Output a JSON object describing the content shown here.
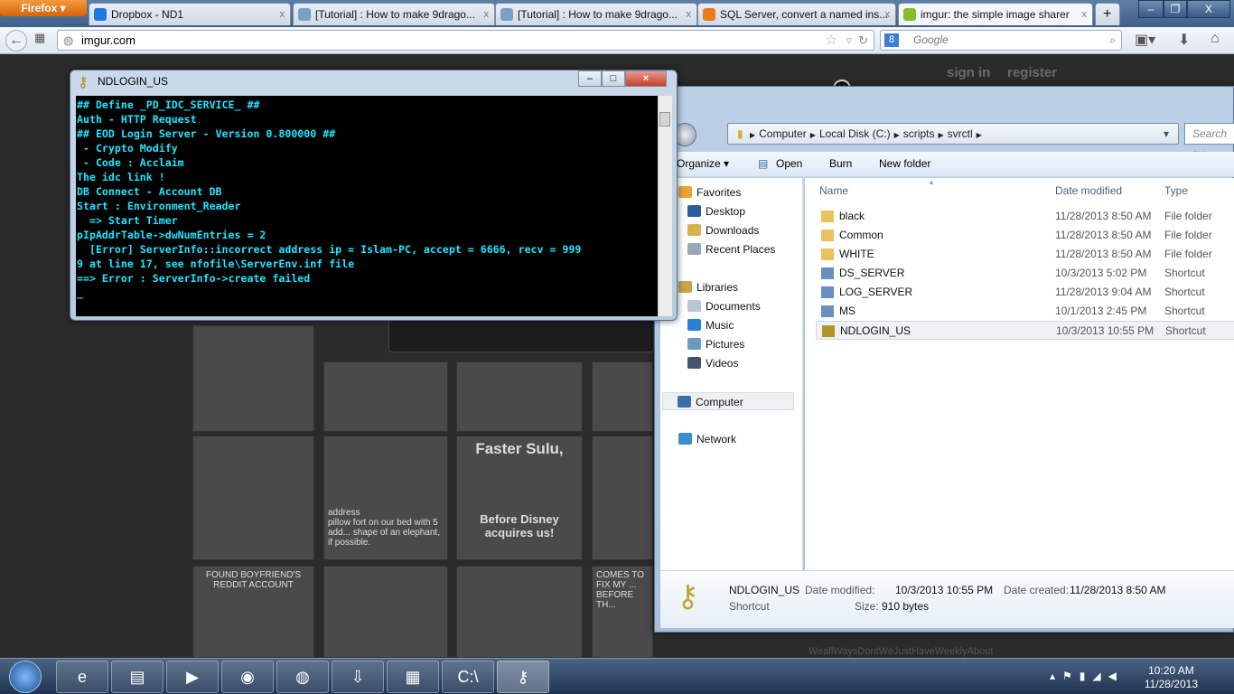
{
  "browser": {
    "menu_label": "Firefox",
    "tabs": [
      {
        "label": "Dropbox - ND1",
        "icon": "dropbox-icon",
        "color": "#1f7ae0"
      },
      {
        "label": "[Tutorial] : How to make 9drago...",
        "icon": "forum-icon",
        "color": "#7aa0c8"
      },
      {
        "label": "[Tutorial] : How to make 9drago...",
        "icon": "forum-icon",
        "color": "#7aa0c8"
      },
      {
        "label": "SQL Server, convert a named ins...",
        "icon": "stackoverflow-icon",
        "color": "#e87d1e"
      },
      {
        "label": "imgur: the simple image sharer",
        "icon": "imgur-icon",
        "color": "#85bf25"
      }
    ],
    "new_tab": "+",
    "url": "imgur.com",
    "search_placeholder": "Google"
  },
  "imgur": {
    "sign_in": "sign in",
    "register": "register",
    "thumbs": [
      "Faster Sulu,",
      "Before Disney acquires us!",
      "FOUND BOYFRIEND'S REDDIT ACCOUNT",
      "COMES TO FIX MY ... BEFORE TH...",
      "address",
      "pillow fort on our bed with 5 add... shape of an elephant, if possible.",
      "WeallWaysDontWeJustHaveWeeklyAbout"
    ]
  },
  "console": {
    "title": "NDLOGIN_US",
    "lines": [
      "## Define _PD_IDC_SERVICE_ ##",
      "Auth - HTTP Request",
      "## EOD Login Server - Version 0.800000 ##",
      "",
      " - Crypto Modify",
      " - Code : Acclaim",
      "The idc link !",
      "DB Connect - Account DB",
      "Start : Environment_Reader",
      "  => Start Timer",
      "pIpAddrTable->dwNumEntries = 2",
      "  [Error] ServerInfo::incorrect address ip = Islam-PC, accept = 6666, recv = 999",
      "9 at line 17, see nfofile\\ServerEnv.inf file",
      "==> Error : ServerInfo->create failed",
      "_"
    ],
    "text_color": "#1ee6ff"
  },
  "explorer": {
    "breadcrumb": [
      "Computer",
      "Local Disk (C:)",
      "scripts",
      "svrctl"
    ],
    "search_placeholder": "Search sv",
    "toolbar": {
      "organize": "Organize ▾",
      "open": "Open",
      "burn": "Burn",
      "new_folder": "New folder"
    },
    "nav": [
      {
        "label": "Favorites",
        "icon": "star-icon",
        "color": "#e8a33a"
      },
      {
        "label": "Desktop",
        "icon": "desktop-icon",
        "color": "#2c5d9a"
      },
      {
        "label": "Downloads",
        "icon": "downloads-icon",
        "color": "#d9b14a"
      },
      {
        "label": "Recent Places",
        "icon": "recent-places-icon",
        "color": "#9aa7b4"
      },
      {
        "label": "Libraries",
        "icon": "libraries-icon",
        "color": "#c9a54b"
      },
      {
        "label": "Documents",
        "icon": "documents-icon",
        "color": "#b8c6d4"
      },
      {
        "label": "Music",
        "icon": "music-icon",
        "color": "#2a7fd4"
      },
      {
        "label": "Pictures",
        "icon": "pictures-icon",
        "color": "#6c98c4"
      },
      {
        "label": "Videos",
        "icon": "videos-icon",
        "color": "#44556a"
      },
      {
        "label": "Computer",
        "icon": "computer-icon",
        "color": "#3a6ea8"
      },
      {
        "label": "Network",
        "icon": "network-icon",
        "color": "#3a8ed0"
      }
    ],
    "columns": {
      "name": "Name",
      "date": "Date modified",
      "type": "Type"
    },
    "files": [
      {
        "name": "black",
        "date": "11/28/2013 8:50 AM",
        "type": "File folder",
        "icon": "folder-icon"
      },
      {
        "name": "Common",
        "date": "11/28/2013 8:50 AM",
        "type": "File folder",
        "icon": "folder-icon"
      },
      {
        "name": "WHITE",
        "date": "11/28/2013 8:50 AM",
        "type": "File folder",
        "icon": "folder-icon"
      },
      {
        "name": "DS_SERVER",
        "date": "10/3/2013 5:02 PM",
        "type": "Shortcut",
        "icon": "shortcut-icon"
      },
      {
        "name": "LOG_SERVER",
        "date": "11/28/2013 9:04 AM",
        "type": "Shortcut",
        "icon": "shortcut-icon"
      },
      {
        "name": "MS",
        "date": "10/1/2013 2:45 PM",
        "type": "Shortcut",
        "icon": "shortcut-icon"
      },
      {
        "name": "NDLOGIN_US",
        "date": "10/3/2013 10:55 PM",
        "type": "Shortcut",
        "icon": "keys-shortcut-icon",
        "selected": true
      }
    ],
    "details": {
      "name": "NDLOGIN_US",
      "type": "Shortcut",
      "modified_label": "Date modified:",
      "modified": "10/3/2013 10:55 PM",
      "created_label": "Date created:",
      "created": "11/28/2013 8:50 AM",
      "size_label": "Size:",
      "size": "910 bytes"
    }
  },
  "taskbar": {
    "apps": [
      "ie-icon",
      "explorer-icon",
      "media-player-icon",
      "chrome-icon",
      "firefox-icon",
      "download-manager-icon",
      "control-panel-icon",
      "cmd-icon",
      "keys-icon"
    ],
    "time": "10:20 AM",
    "date": "11/28/2013"
  }
}
